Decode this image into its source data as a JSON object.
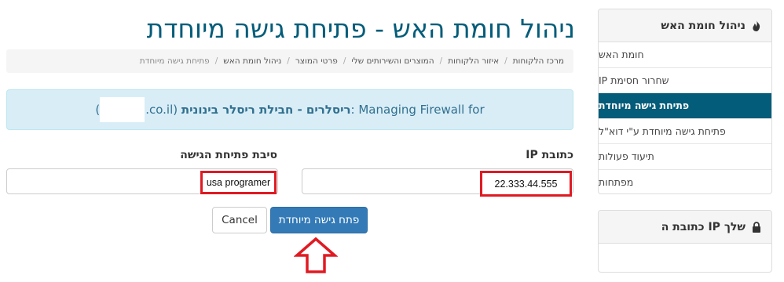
{
  "sidebar": {
    "title": "ניהול חומת האש",
    "items": [
      {
        "label": "חומת האש"
      },
      {
        "label": "שחרור חסימת IP"
      },
      {
        "label": "פתיחת גישה מיוחדת"
      },
      {
        "label": "פתיחת גישה מיוחדת ע\"י דוא\"ל"
      },
      {
        "label": "תיעוד פעולות"
      },
      {
        "label": "מפתחות"
      }
    ],
    "active_index": 2,
    "ip_panel_title": "כתובת ה IP שלך"
  },
  "page": {
    "title": "ניהול חומת האש - פתיחת גישה מיוחדת"
  },
  "breadcrumb": [
    "מרכז הלקוחות",
    "איזור הלקוחות",
    "המוצרים והשירותים שלי",
    "פרטי המוצר",
    "ניהול חומת האש",
    "פתיחת גישה מיוחדת"
  ],
  "alert": {
    "prefix": "Managing Firewall for",
    "product": "ריסלרים - חבילת ריסלר בינונית",
    "domain_suffix": ".co.il)",
    "domain_open": "("
  },
  "form": {
    "ip_label": "כתובת IP",
    "ip_value": "22.333.44.555",
    "reason_label": "סיבת פתיחת הגישה",
    "reason_value": "usa programer",
    "submit_label": "פתח גישה מיוחדת",
    "cancel_label": "Cancel"
  },
  "colors": {
    "brand": "#035c79",
    "primary_button": "#337ab7",
    "highlight": "#e01a22",
    "alert_bg": "#d9edf7"
  },
  "icons": {
    "sidebar_title_icon": "fire-icon",
    "ip_panel_icon": "lock-icon",
    "annotation": "up-arrow-icon"
  }
}
